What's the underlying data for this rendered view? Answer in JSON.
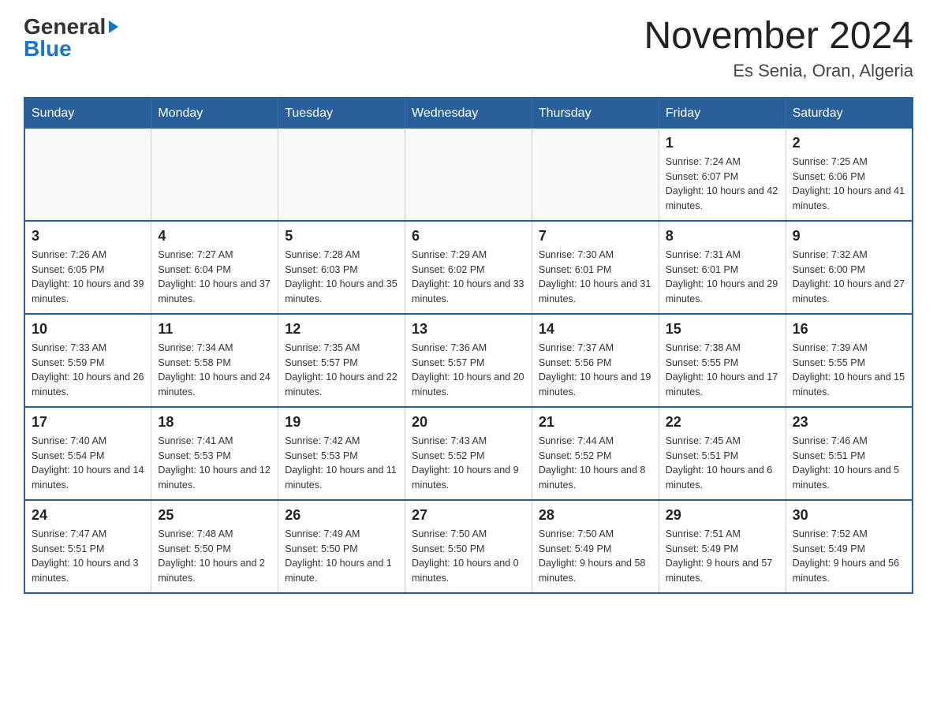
{
  "header": {
    "logo": {
      "general": "General",
      "blue": "Blue"
    },
    "title": "November 2024",
    "location": "Es Senia, Oran, Algeria"
  },
  "days_of_week": [
    "Sunday",
    "Monday",
    "Tuesday",
    "Wednesday",
    "Thursday",
    "Friday",
    "Saturday"
  ],
  "weeks": [
    [
      {
        "day": "",
        "info": ""
      },
      {
        "day": "",
        "info": ""
      },
      {
        "day": "",
        "info": ""
      },
      {
        "day": "",
        "info": ""
      },
      {
        "day": "",
        "info": ""
      },
      {
        "day": "1",
        "info": "Sunrise: 7:24 AM\nSunset: 6:07 PM\nDaylight: 10 hours and 42 minutes."
      },
      {
        "day": "2",
        "info": "Sunrise: 7:25 AM\nSunset: 6:06 PM\nDaylight: 10 hours and 41 minutes."
      }
    ],
    [
      {
        "day": "3",
        "info": "Sunrise: 7:26 AM\nSunset: 6:05 PM\nDaylight: 10 hours and 39 minutes."
      },
      {
        "day": "4",
        "info": "Sunrise: 7:27 AM\nSunset: 6:04 PM\nDaylight: 10 hours and 37 minutes."
      },
      {
        "day": "5",
        "info": "Sunrise: 7:28 AM\nSunset: 6:03 PM\nDaylight: 10 hours and 35 minutes."
      },
      {
        "day": "6",
        "info": "Sunrise: 7:29 AM\nSunset: 6:02 PM\nDaylight: 10 hours and 33 minutes."
      },
      {
        "day": "7",
        "info": "Sunrise: 7:30 AM\nSunset: 6:01 PM\nDaylight: 10 hours and 31 minutes."
      },
      {
        "day": "8",
        "info": "Sunrise: 7:31 AM\nSunset: 6:01 PM\nDaylight: 10 hours and 29 minutes."
      },
      {
        "day": "9",
        "info": "Sunrise: 7:32 AM\nSunset: 6:00 PM\nDaylight: 10 hours and 27 minutes."
      }
    ],
    [
      {
        "day": "10",
        "info": "Sunrise: 7:33 AM\nSunset: 5:59 PM\nDaylight: 10 hours and 26 minutes."
      },
      {
        "day": "11",
        "info": "Sunrise: 7:34 AM\nSunset: 5:58 PM\nDaylight: 10 hours and 24 minutes."
      },
      {
        "day": "12",
        "info": "Sunrise: 7:35 AM\nSunset: 5:57 PM\nDaylight: 10 hours and 22 minutes."
      },
      {
        "day": "13",
        "info": "Sunrise: 7:36 AM\nSunset: 5:57 PM\nDaylight: 10 hours and 20 minutes."
      },
      {
        "day": "14",
        "info": "Sunrise: 7:37 AM\nSunset: 5:56 PM\nDaylight: 10 hours and 19 minutes."
      },
      {
        "day": "15",
        "info": "Sunrise: 7:38 AM\nSunset: 5:55 PM\nDaylight: 10 hours and 17 minutes."
      },
      {
        "day": "16",
        "info": "Sunrise: 7:39 AM\nSunset: 5:55 PM\nDaylight: 10 hours and 15 minutes."
      }
    ],
    [
      {
        "day": "17",
        "info": "Sunrise: 7:40 AM\nSunset: 5:54 PM\nDaylight: 10 hours and 14 minutes."
      },
      {
        "day": "18",
        "info": "Sunrise: 7:41 AM\nSunset: 5:53 PM\nDaylight: 10 hours and 12 minutes."
      },
      {
        "day": "19",
        "info": "Sunrise: 7:42 AM\nSunset: 5:53 PM\nDaylight: 10 hours and 11 minutes."
      },
      {
        "day": "20",
        "info": "Sunrise: 7:43 AM\nSunset: 5:52 PM\nDaylight: 10 hours and 9 minutes."
      },
      {
        "day": "21",
        "info": "Sunrise: 7:44 AM\nSunset: 5:52 PM\nDaylight: 10 hours and 8 minutes."
      },
      {
        "day": "22",
        "info": "Sunrise: 7:45 AM\nSunset: 5:51 PM\nDaylight: 10 hours and 6 minutes."
      },
      {
        "day": "23",
        "info": "Sunrise: 7:46 AM\nSunset: 5:51 PM\nDaylight: 10 hours and 5 minutes."
      }
    ],
    [
      {
        "day": "24",
        "info": "Sunrise: 7:47 AM\nSunset: 5:51 PM\nDaylight: 10 hours and 3 minutes."
      },
      {
        "day": "25",
        "info": "Sunrise: 7:48 AM\nSunset: 5:50 PM\nDaylight: 10 hours and 2 minutes."
      },
      {
        "day": "26",
        "info": "Sunrise: 7:49 AM\nSunset: 5:50 PM\nDaylight: 10 hours and 1 minute."
      },
      {
        "day": "27",
        "info": "Sunrise: 7:50 AM\nSunset: 5:50 PM\nDaylight: 10 hours and 0 minutes."
      },
      {
        "day": "28",
        "info": "Sunrise: 7:50 AM\nSunset: 5:49 PM\nDaylight: 9 hours and 58 minutes."
      },
      {
        "day": "29",
        "info": "Sunrise: 7:51 AM\nSunset: 5:49 PM\nDaylight: 9 hours and 57 minutes."
      },
      {
        "day": "30",
        "info": "Sunrise: 7:52 AM\nSunset: 5:49 PM\nDaylight: 9 hours and 56 minutes."
      }
    ]
  ]
}
